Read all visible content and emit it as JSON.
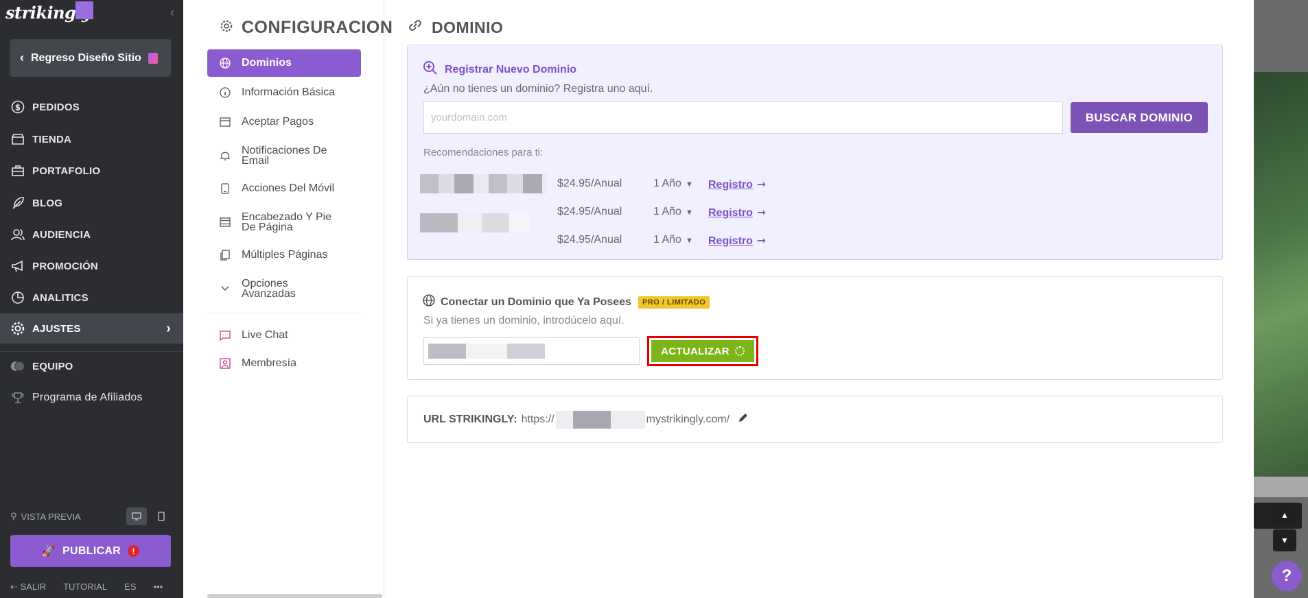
{
  "sidebar": {
    "logo": "strikingly",
    "back_label": "Regreso Diseño Sitio",
    "items": [
      {
        "label": "PEDIDOS",
        "icon": "dollar-circle-icon"
      },
      {
        "label": "TIENDA",
        "icon": "store-icon"
      },
      {
        "label": "PORTAFOLIO",
        "icon": "briefcase-icon"
      },
      {
        "label": "BLOG",
        "icon": "feather-icon"
      },
      {
        "label": "AUDIENCIA",
        "icon": "users-icon"
      },
      {
        "label": "PROMOCIÓN",
        "icon": "megaphone-icon"
      },
      {
        "label": "ANALITICS",
        "icon": "chart-icon"
      },
      {
        "label": "AJUSTES",
        "icon": "gear-icon"
      },
      {
        "label": "EQUIPO",
        "icon": "team-icon"
      },
      {
        "label": "Programa de Afiliados",
        "icon": "trophy-icon"
      }
    ],
    "preview_label": "VISTA PREVIA",
    "publish_label": "PUBLICAR",
    "publish_alert": "!",
    "footer": {
      "exit": "SALIR",
      "tutorial": "TUTORIAL",
      "lang": "ES",
      "more": "•••"
    }
  },
  "subnav": {
    "title": "CONFIGURACION",
    "items": [
      {
        "label": "Dominios"
      },
      {
        "label": "Información Básica"
      },
      {
        "label": "Aceptar Pagos"
      },
      {
        "label_1": "Notificaciones De",
        "label_2": "Email"
      },
      {
        "label": "Acciones Del Móvil"
      },
      {
        "label_1": "Encabezado Y Pie",
        "label_2": "De Página"
      },
      {
        "label": "Múltiples Páginas"
      },
      {
        "label_1": "Opciones",
        "label_2": "Avanzadas"
      },
      {
        "label": "Live Chat"
      },
      {
        "label": "Membresía"
      }
    ]
  },
  "main": {
    "title": "DOMINIO",
    "register": {
      "heading": "Registrar Nuevo Dominio",
      "subtitle": "¿Aún no tienes un dominio? Registra uno aquí.",
      "placeholder": "yourdomain.com",
      "search_label": "BUSCAR DOMINIO",
      "recommendations_label": "Recomendaciones para ti:",
      "rows": [
        {
          "price": "$24.95/Anual",
          "period": "1 Año",
          "link": "Registro"
        },
        {
          "price": "$24.95/Anual",
          "period": "1 Año",
          "link": "Registro"
        },
        {
          "price": "$24.95/Anual",
          "period": "1 Año",
          "link": "Registro"
        }
      ]
    },
    "connect": {
      "heading": "Conectar un Dominio que Ya Posees",
      "badge": "PRO / LIMITADO",
      "subtitle": "Si ya tienes un dominio, introdúcelo aquí.",
      "update_label": "ACTUALIZAR"
    },
    "url": {
      "label": "URL STRIKINGLY:",
      "prefix": "https://",
      "suffix": "mystrikingly.com/"
    }
  },
  "colors": {
    "accent": "#8b5cd0",
    "update": "#7cb518",
    "badge": "#f3c62b",
    "sidebar": "#2b2d31"
  }
}
